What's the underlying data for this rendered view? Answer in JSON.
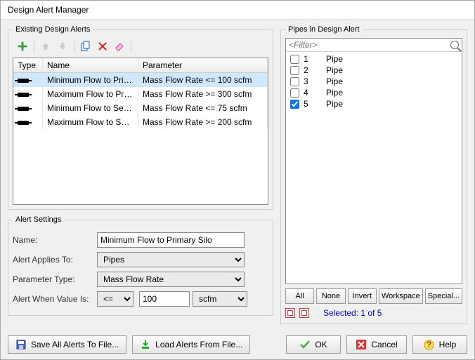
{
  "window": {
    "title": "Design Alert Manager"
  },
  "existing": {
    "legend": "Existing Design Alerts",
    "headers": {
      "type": "Type",
      "name": "Name",
      "param": "Parameter"
    },
    "rows": [
      {
        "name": "Minimum Flow to Primar...",
        "param": "Mass Flow Rate <= 100 scfm",
        "selected": true
      },
      {
        "name": "Maximum Flow to Primar...",
        "param": "Mass Flow Rate >= 300 scfm",
        "selected": false
      },
      {
        "name": "Minimum Flow to Second..",
        "param": "Mass Flow Rate <= 75 scfm",
        "selected": false
      },
      {
        "name": "Maximum Flow to Second..",
        "param": "Mass Flow Rate >= 200 scfm",
        "selected": false
      }
    ]
  },
  "settings": {
    "legend": "Alert Settings",
    "labels": {
      "name": "Name:",
      "applies": "Alert Applies To:",
      "ptype": "Parameter Type:",
      "when": "Alert When Value Is:"
    },
    "name": "Minimum Flow to Primary Silo",
    "applies": "Pipes",
    "ptype": "Mass Flow Rate",
    "op": "<=",
    "value": "100",
    "unit": "scfm"
  },
  "pipes": {
    "legend": "Pipes in Design Alert",
    "filter_placeholder": "<Filter>",
    "items": [
      {
        "num": "1",
        "label": "Pipe",
        "checked": false
      },
      {
        "num": "2",
        "label": "Pipe",
        "checked": false
      },
      {
        "num": "3",
        "label": "Pipe",
        "checked": false
      },
      {
        "num": "4",
        "label": "Pipe",
        "checked": false
      },
      {
        "num": "5",
        "label": "Pipe",
        "checked": true
      }
    ],
    "buttons": {
      "all": "All",
      "none": "None",
      "invert": "Invert",
      "workspace": "Workspace",
      "special": "Special..."
    },
    "selected_text": "Selected: 1 of 5"
  },
  "bottom": {
    "save": "Save All Alerts To File...",
    "load": "Load Alerts From File...",
    "ok": "OK",
    "cancel": "Cancel",
    "help": "Help"
  }
}
